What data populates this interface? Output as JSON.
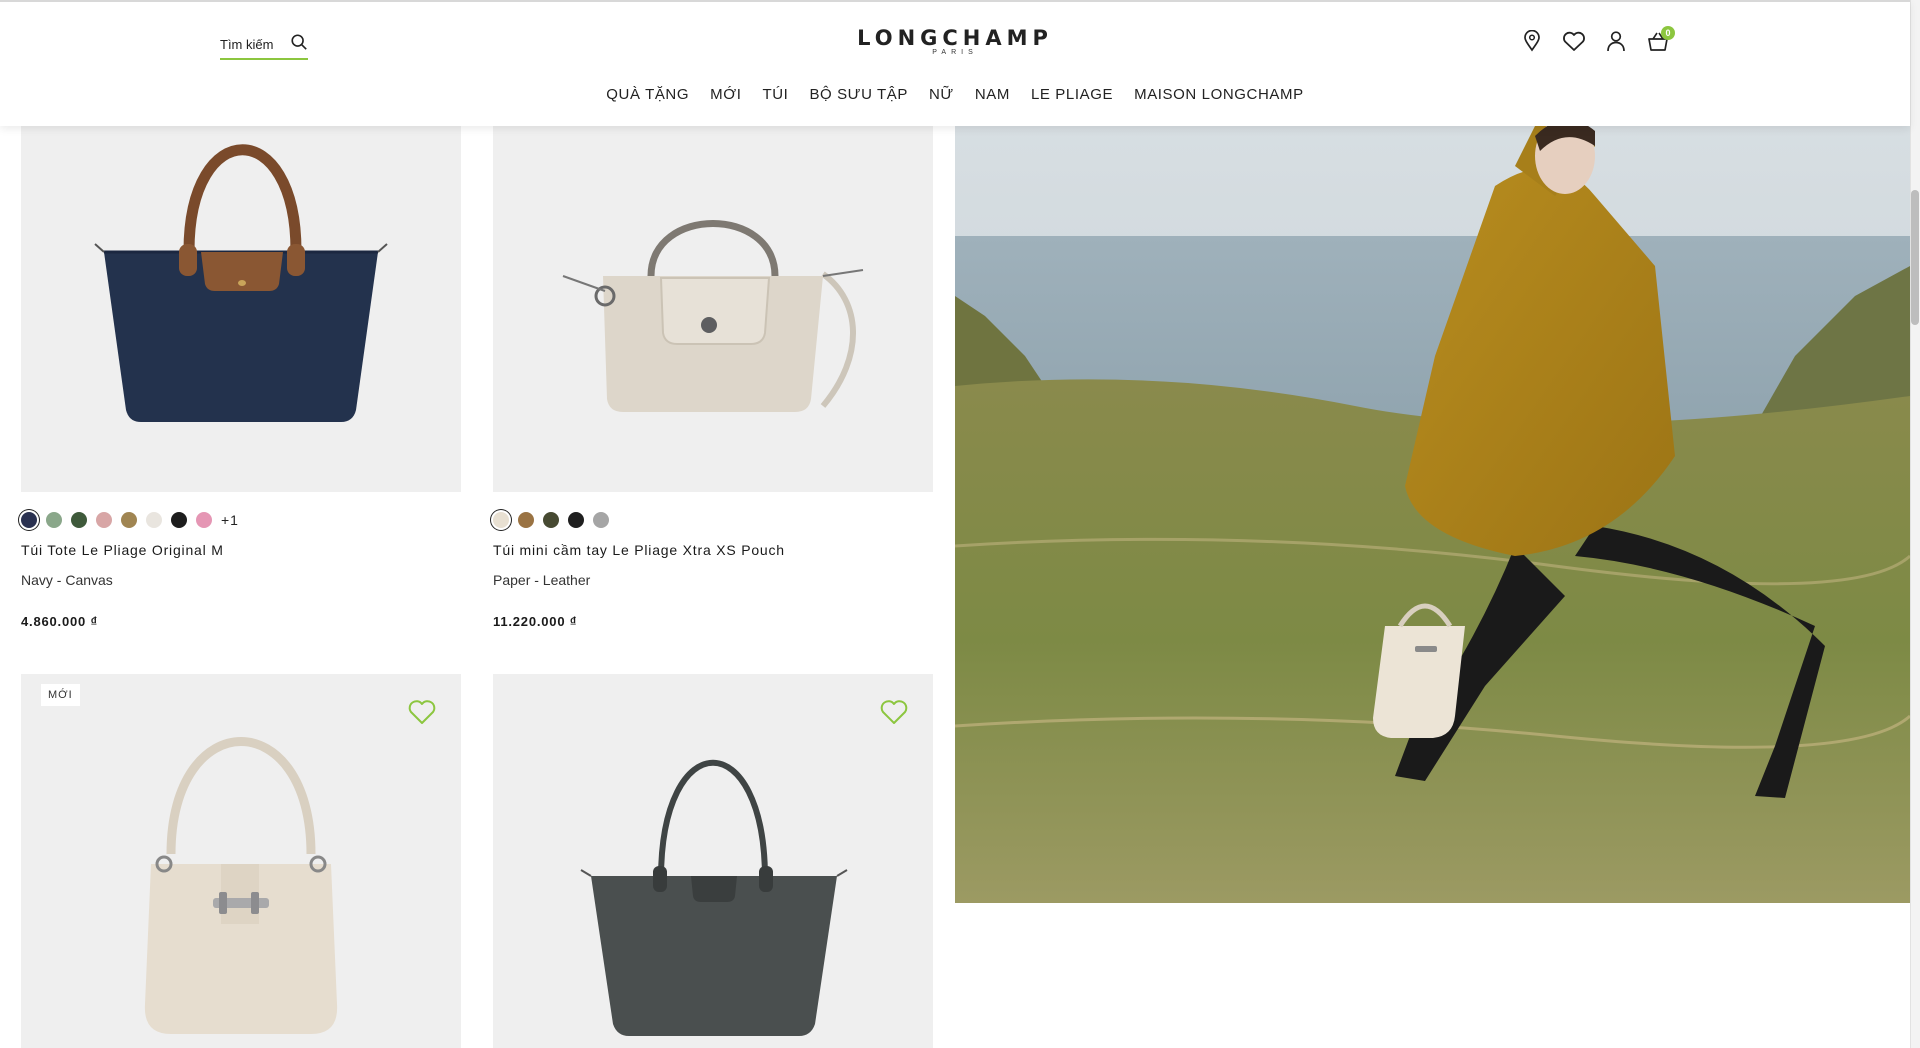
{
  "header": {
    "search_label": "Tìm kiếm",
    "brand": "LONGCHAMP",
    "brand_sub": "PARIS",
    "cart_count": "0",
    "nav": [
      "QUÀ TẶNG",
      "MỚI",
      "TÚI",
      "BỘ SƯU TẬP",
      "NỮ",
      "NAM",
      "LE PLIAGE",
      "MAISON LONGCHAMP"
    ]
  },
  "products": [
    {
      "name": "Túi Tote Le Pliage Original M",
      "material": "Navy - Canvas",
      "price": "4.860.000 ₫",
      "swatches": [
        "#2a3150",
        "#8aa78a",
        "#3f5a3b",
        "#d8a6a6",
        "#a08552",
        "#e9e5df",
        "#1d1d1d",
        "#e596b4"
      ],
      "more": "+1"
    },
    {
      "name": "Túi mini cầm tay Le Pliage Xtra XS Pouch",
      "material": "Paper - Leather",
      "price": "11.220.000 ₫",
      "swatches": [
        "#e8e0d2",
        "#9a7343",
        "#474a32",
        "#1f1f1f",
        "#a5a5a5"
      ]
    },
    {
      "badge": "MỚI"
    },
    {}
  ],
  "colors": {
    "accent": "#8cc63f",
    "card_bg": "#efefef"
  }
}
